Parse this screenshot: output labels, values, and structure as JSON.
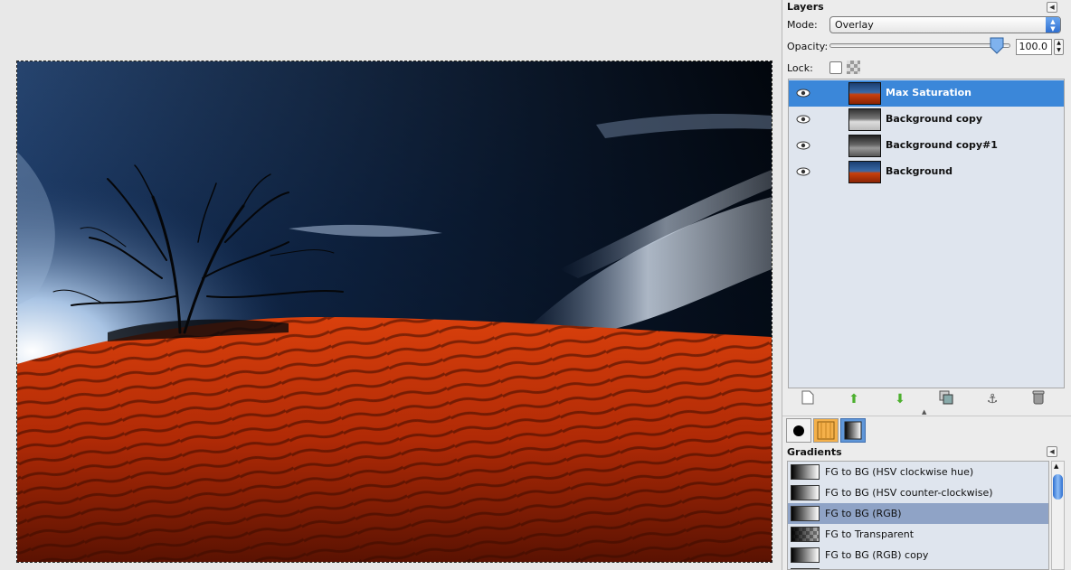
{
  "layers_panel": {
    "title": "Layers",
    "mode_label": "Mode:",
    "mode_value": "Overlay",
    "opacity_label": "Opacity:",
    "opacity_value": "100.0",
    "lock_label": "Lock:",
    "layers": [
      {
        "name": "Max Saturation",
        "selected": true,
        "visible": true,
        "thumb": "color"
      },
      {
        "name": "Background copy",
        "selected": false,
        "visible": true,
        "thumb": "bw-light"
      },
      {
        "name": "Background copy#1",
        "selected": false,
        "visible": true,
        "thumb": "bw"
      },
      {
        "name": "Background",
        "selected": false,
        "visible": true,
        "thumb": "color"
      }
    ],
    "buttons": [
      "new-layer-icon",
      "raise-layer-icon",
      "lower-layer-icon",
      "duplicate-layer-icon",
      "anchor-layer-icon",
      "delete-layer-icon"
    ]
  },
  "gradients_panel": {
    "title": "Gradients",
    "items": [
      {
        "name": "FG to BG (HSV clockwise hue)",
        "selected": false
      },
      {
        "name": "FG to BG (HSV counter-clockwise)",
        "selected": false
      },
      {
        "name": "FG to BG (RGB)",
        "selected": true
      },
      {
        "name": "FG to Transparent",
        "selected": false
      },
      {
        "name": "FG to BG (RGB) copy",
        "selected": false
      }
    ]
  },
  "colors": {
    "selection": "#3b87d9",
    "gradient_selection": "#8fa3c6",
    "sand": "#c2320a",
    "sky": "#0d2642"
  }
}
